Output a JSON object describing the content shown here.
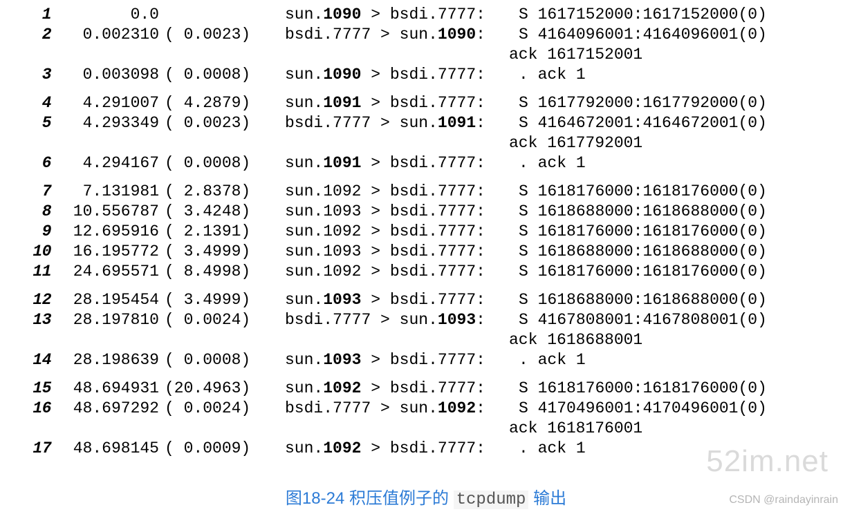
{
  "caption": {
    "prefix": "图18-24 积压值例子的 ",
    "mono": "tcpdump",
    "suffix": " 输出"
  },
  "watermarks": {
    "site": "52im.net",
    "csdn": "CSDN @raindayinrain"
  },
  "rows": [
    {
      "idx": "1",
      "ts": "0.0",
      "delta": "",
      "src_host": "sun",
      "src_port": "1090",
      "src_bold": true,
      "dst_host": "bsdi",
      "dst_port": "7777",
      "dst_bold": false,
      "flag": "S",
      "info": "1617152000:1617152000(0)",
      "ack": "",
      "gap_before": false
    },
    {
      "idx": "2",
      "ts": "0.002310",
      "delta": "( 0.0023)",
      "src_host": "bsdi",
      "src_port": "7777",
      "src_bold": false,
      "dst_host": "sun",
      "dst_port": "1090",
      "dst_bold": true,
      "flag": "S",
      "info": "4164096001:4164096001(0)",
      "ack": "ack 1617152001",
      "gap_before": false
    },
    {
      "idx": "3",
      "ts": "0.003098",
      "delta": "( 0.0008)",
      "src_host": "sun",
      "src_port": "1090",
      "src_bold": true,
      "dst_host": "bsdi",
      "dst_port": "7777",
      "dst_bold": false,
      "flag": ".",
      "info": "ack 1",
      "ack": "",
      "gap_before": false
    },
    {
      "idx": "4",
      "ts": "4.291007",
      "delta": "( 4.2879)",
      "src_host": "sun",
      "src_port": "1091",
      "src_bold": true,
      "dst_host": "bsdi",
      "dst_port": "7777",
      "dst_bold": false,
      "flag": "S",
      "info": "1617792000:1617792000(0)",
      "ack": "",
      "gap_before": true
    },
    {
      "idx": "5",
      "ts": "4.293349",
      "delta": "( 0.0023)",
      "src_host": "bsdi",
      "src_port": "7777",
      "src_bold": false,
      "dst_host": "sun",
      "dst_port": "1091",
      "dst_bold": true,
      "flag": "S",
      "info": "4164672001:4164672001(0)",
      "ack": "ack 1617792001",
      "gap_before": false
    },
    {
      "idx": "6",
      "ts": "4.294167",
      "delta": "( 0.0008)",
      "src_host": "sun",
      "src_port": "1091",
      "src_bold": true,
      "dst_host": "bsdi",
      "dst_port": "7777",
      "dst_bold": false,
      "flag": ".",
      "info": "ack 1",
      "ack": "",
      "gap_before": false
    },
    {
      "idx": "7",
      "ts": "7.131981",
      "delta": "( 2.8378)",
      "src_host": "sun",
      "src_port": "1092",
      "src_bold": false,
      "dst_host": "bsdi",
      "dst_port": "7777",
      "dst_bold": false,
      "flag": "S",
      "info": "1618176000:1618176000(0)",
      "ack": "",
      "gap_before": true
    },
    {
      "idx": "8",
      "ts": "10.556787",
      "delta": "( 3.4248)",
      "src_host": "sun",
      "src_port": "1093",
      "src_bold": false,
      "dst_host": "bsdi",
      "dst_port": "7777",
      "dst_bold": false,
      "flag": "S",
      "info": "1618688000:1618688000(0)",
      "ack": "",
      "gap_before": false
    },
    {
      "idx": "9",
      "ts": "12.695916",
      "delta": "( 2.1391)",
      "src_host": "sun",
      "src_port": "1092",
      "src_bold": false,
      "dst_host": "bsdi",
      "dst_port": "7777",
      "dst_bold": false,
      "flag": "S",
      "info": "1618176000:1618176000(0)",
      "ack": "",
      "gap_before": false
    },
    {
      "idx": "10",
      "ts": "16.195772",
      "delta": "( 3.4999)",
      "src_host": "sun",
      "src_port": "1093",
      "src_bold": false,
      "dst_host": "bsdi",
      "dst_port": "7777",
      "dst_bold": false,
      "flag": "S",
      "info": "1618688000:1618688000(0)",
      "ack": "",
      "gap_before": false
    },
    {
      "idx": "11",
      "ts": "24.695571",
      "delta": "( 8.4998)",
      "src_host": "sun",
      "src_port": "1092",
      "src_bold": false,
      "dst_host": "bsdi",
      "dst_port": "7777",
      "dst_bold": false,
      "flag": "S",
      "info": "1618176000:1618176000(0)",
      "ack": "",
      "gap_before": false
    },
    {
      "idx": "12",
      "ts": "28.195454",
      "delta": "( 3.4999)",
      "src_host": "sun",
      "src_port": "1093",
      "src_bold": true,
      "dst_host": "bsdi",
      "dst_port": "7777",
      "dst_bold": false,
      "flag": "S",
      "info": "1618688000:1618688000(0)",
      "ack": "",
      "gap_before": true
    },
    {
      "idx": "13",
      "ts": "28.197810",
      "delta": "( 0.0024)",
      "src_host": "bsdi",
      "src_port": "7777",
      "src_bold": false,
      "dst_host": "sun",
      "dst_port": "1093",
      "dst_bold": true,
      "flag": "S",
      "info": "4167808001:4167808001(0)",
      "ack": "ack 1618688001",
      "gap_before": false
    },
    {
      "idx": "14",
      "ts": "28.198639",
      "delta": "( 0.0008)",
      "src_host": "sun",
      "src_port": "1093",
      "src_bold": true,
      "dst_host": "bsdi",
      "dst_port": "7777",
      "dst_bold": false,
      "flag": ".",
      "info": "ack 1",
      "ack": "",
      "gap_before": false
    },
    {
      "idx": "15",
      "ts": "48.694931",
      "delta": "(20.4963)",
      "src_host": "sun",
      "src_port": "1092",
      "src_bold": true,
      "dst_host": "bsdi",
      "dst_port": "7777",
      "dst_bold": false,
      "flag": "S",
      "info": "1618176000:1618176000(0)",
      "ack": "",
      "gap_before": true
    },
    {
      "idx": "16",
      "ts": "48.697292",
      "delta": "( 0.0024)",
      "src_host": "bsdi",
      "src_port": "7777",
      "src_bold": false,
      "dst_host": "sun",
      "dst_port": "1092",
      "dst_bold": true,
      "flag": "S",
      "info": "4170496001:4170496001(0)",
      "ack": "ack 1618176001",
      "gap_before": false
    },
    {
      "idx": "17",
      "ts": "48.698145",
      "delta": "( 0.0009)",
      "src_host": "sun",
      "src_port": "1092",
      "src_bold": true,
      "dst_host": "bsdi",
      "dst_port": "7777",
      "dst_bold": false,
      "flag": ".",
      "info": "ack 1",
      "ack": "",
      "gap_before": false
    }
  ]
}
